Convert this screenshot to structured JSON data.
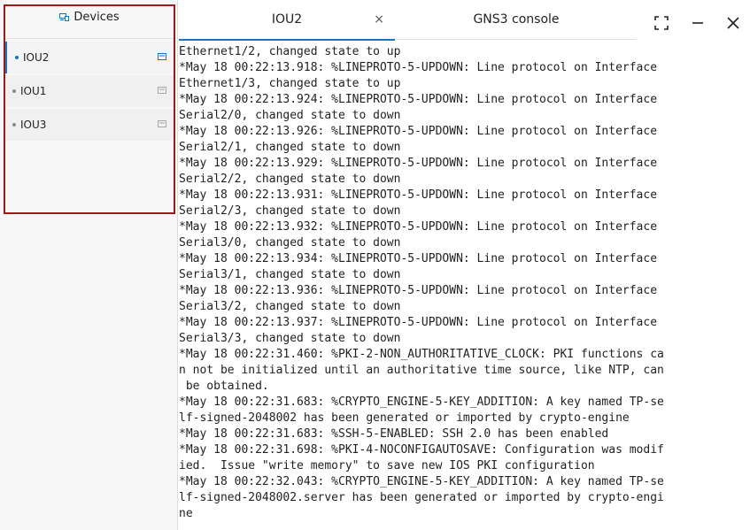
{
  "sidebar": {
    "header": {
      "icon": "devices-icon",
      "label": "Devices"
    },
    "items": [
      {
        "label": "IOU2",
        "active": true,
        "icon": "terminal-icon"
      },
      {
        "label": "IOU1",
        "active": false,
        "icon": "terminal-icon"
      },
      {
        "label": "IOU3",
        "active": false,
        "icon": "terminal-icon"
      }
    ]
  },
  "tabs": [
    {
      "label": "IOU2",
      "active": true,
      "close_glyph": "×"
    },
    {
      "label": "GNS3 console",
      "active": false
    }
  ],
  "window_controls": [
    "fullscreen-icon",
    "minimize-icon",
    "close-icon"
  ],
  "colors": {
    "accent": "#1a73c8",
    "highlight_border": "#9b1b1b"
  },
  "terminal": {
    "lines": [
      "Ethernet1/2, changed state to up",
      "*May 18 00:22:13.918: %LINEPROTO-5-UPDOWN: Line protocol on Interface",
      "Ethernet1/3, changed state to up",
      "*May 18 00:22:13.924: %LINEPROTO-5-UPDOWN: Line protocol on Interface",
      "Serial2/0, changed state to down",
      "*May 18 00:22:13.926: %LINEPROTO-5-UPDOWN: Line protocol on Interface",
      "Serial2/1, changed state to down",
      "*May 18 00:22:13.929: %LINEPROTO-5-UPDOWN: Line protocol on Interface",
      "Serial2/2, changed state to down",
      "*May 18 00:22:13.931: %LINEPROTO-5-UPDOWN: Line protocol on Interface",
      "Serial2/3, changed state to down",
      "*May 18 00:22:13.932: %LINEPROTO-5-UPDOWN: Line protocol on Interface",
      "Serial3/0, changed state to down",
      "*May 18 00:22:13.934: %LINEPROTO-5-UPDOWN: Line protocol on Interface",
      "Serial3/1, changed state to down",
      "*May 18 00:22:13.936: %LINEPROTO-5-UPDOWN: Line protocol on Interface",
      "Serial3/2, changed state to down",
      "*May 18 00:22:13.937: %LINEPROTO-5-UPDOWN: Line protocol on Interface",
      "Serial3/3, changed state to down",
      "*May 18 00:22:31.460: %PKI-2-NON_AUTHORITATIVE_CLOCK: PKI functions ca",
      "n not be initialized until an authoritative time source, like NTP, can",
      " be obtained.",
      "*May 18 00:22:31.683: %CRYPTO_ENGINE-5-KEY_ADDITION: A key named TP-se",
      "lf-signed-2048002 has been generated or imported by crypto-engine",
      "*May 18 00:22:31.683: %SSH-5-ENABLED: SSH 2.0 has been enabled",
      "*May 18 00:22:31.698: %PKI-4-NOCONFIGAUTOSAVE: Configuration was modif",
      "ied.  Issue \"write memory\" to save new IOS PKI configuration",
      "*May 18 00:22:32.043: %CRYPTO_ENGINE-5-KEY_ADDITION: A key named TP-se",
      "lf-signed-2048002.server has been generated or imported by crypto-engi",
      "ne"
    ]
  }
}
